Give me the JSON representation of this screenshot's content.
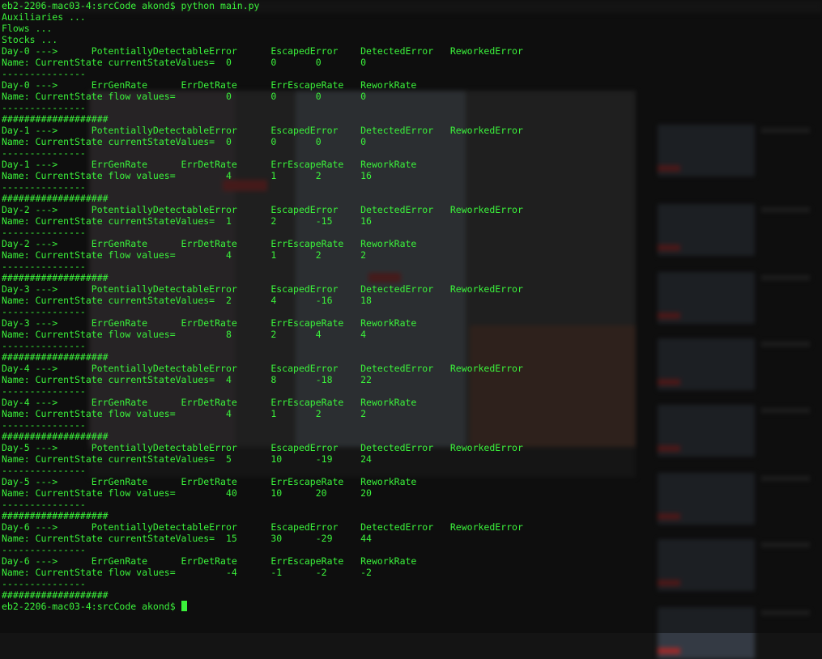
{
  "terminal": {
    "command_line": "eb2-2206-mac03-4:srcCode akond$ python main.py",
    "lines": [
      "Auxiliaries ...",
      "Flows ...",
      "Stocks ...",
      "Day-0 --->      PotentiallyDetectableError      EscapedError    DetectedError   ReworkedError",
      "Name: CurrentState currentStateValues=  0       0       0       0",
      "---------------",
      "Day-0 --->      ErrGenRate      ErrDetRate      ErrEscapeRate   ReworkRate",
      "Name: CurrentState flow values=         0       0       0       0",
      "---------------",
      "###################",
      "Day-1 --->      PotentiallyDetectableError      EscapedError    DetectedError   ReworkedError",
      "Name: CurrentState currentStateValues=  0       0       0       0",
      "---------------",
      "Day-1 --->      ErrGenRate      ErrDetRate      ErrEscapeRate   ReworkRate",
      "Name: CurrentState flow values=         4       1       2       16",
      "---------------",
      "###################",
      "Day-2 --->      PotentiallyDetectableError      EscapedError    DetectedError   ReworkedError",
      "Name: CurrentState currentStateValues=  1       2       -15     16",
      "---------------",
      "Day-2 --->      ErrGenRate      ErrDetRate      ErrEscapeRate   ReworkRate",
      "Name: CurrentState flow values=         4       1       2       2",
      "---------------",
      "###################",
      "Day-3 --->      PotentiallyDetectableError      EscapedError    DetectedError   ReworkedError",
      "Name: CurrentState currentStateValues=  2       4       -16     18",
      "---------------",
      "Day-3 --->      ErrGenRate      ErrDetRate      ErrEscapeRate   ReworkRate",
      "Name: CurrentState flow values=         8       2       4       4",
      "---------------",
      "###################",
      "Day-4 --->      PotentiallyDetectableError      EscapedError    DetectedError   ReworkedError",
      "Name: CurrentState currentStateValues=  4       8       -18     22",
      "---------------",
      "Day-4 --->      ErrGenRate      ErrDetRate      ErrEscapeRate   ReworkRate",
      "Name: CurrentState flow values=         4       1       2       2",
      "---------------",
      "###################",
      "Day-5 --->      PotentiallyDetectableError      EscapedError    DetectedError   ReworkedError",
      "Name: CurrentState currentStateValues=  5       10      -19     24",
      "---------------",
      "Day-5 --->      ErrGenRate      ErrDetRate      ErrEscapeRate   ReworkRate",
      "Name: CurrentState flow values=         40      10      20      20",
      "---------------",
      "###################",
      "Day-6 --->      PotentiallyDetectableError      EscapedError    DetectedError   ReworkedError",
      "Name: CurrentState currentStateValues=  15      30      -29     44",
      "---------------",
      "Day-6 --->      ErrGenRate      ErrDetRate      ErrEscapeRate   ReworkRate",
      "Name: CurrentState flow values=         -4      -1      -2      -2",
      "---------------",
      "###################"
    ],
    "prompt": "eb2-2206-mac03-4:srcCode akond$ ",
    "colors": {
      "text": "#3bf23b",
      "background": "#141414",
      "cursor": "#3bf23b"
    }
  }
}
